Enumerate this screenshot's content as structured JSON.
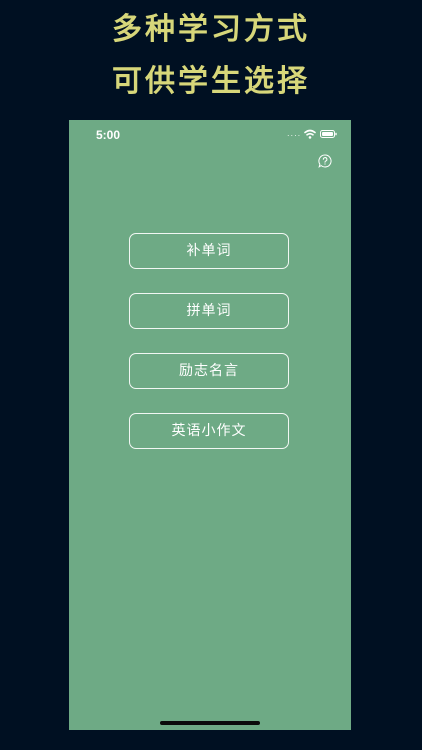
{
  "promo": {
    "line1": "多种学习方式",
    "line2": "可供学生选择",
    "color": "#d7d77a"
  },
  "status_bar": {
    "time": "5:00",
    "signal": "....",
    "icons": [
      "wifi-icon",
      "battery-icon"
    ]
  },
  "header": {
    "help_icon": "help-bubble-icon"
  },
  "menu": {
    "items": [
      {
        "label": "补单词"
      },
      {
        "label": "拼单词"
      },
      {
        "label": "励志名言"
      },
      {
        "label": "英语小作文"
      }
    ]
  },
  "colors": {
    "page_background": "#001022",
    "app_background": "#6eaa85",
    "button_border": "#ffffff",
    "text": "#ffffff"
  }
}
